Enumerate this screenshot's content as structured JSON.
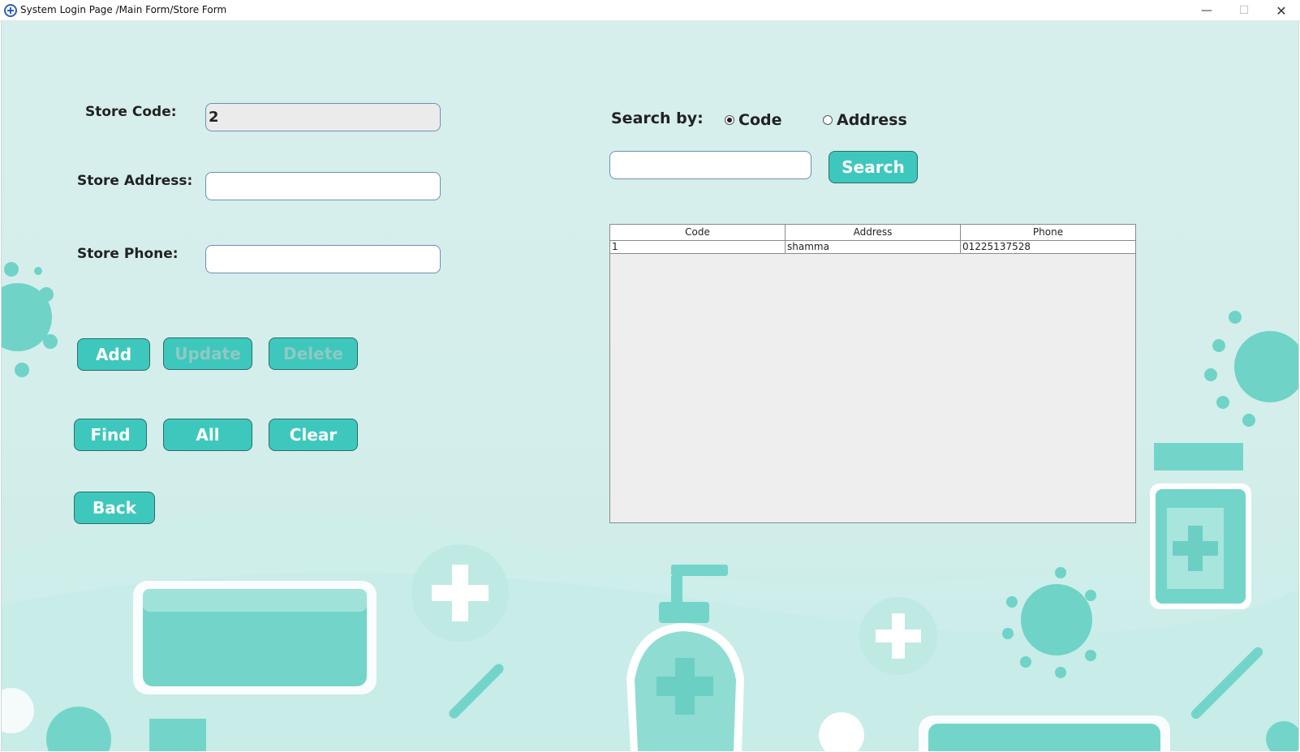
{
  "window": {
    "title": "System Login Page /Main Form/Store Form",
    "minimize_glyph": "—",
    "maximize_glyph": "☐",
    "close_glyph": "✕"
  },
  "form": {
    "store_code_label": "Store Code:",
    "store_code_value": "2",
    "store_address_label": "Store Address:",
    "store_address_value": "",
    "store_phone_label": "Store Phone:",
    "store_phone_value": ""
  },
  "buttons": {
    "add": "Add",
    "update": "Update",
    "delete": "Delete",
    "find": "Find",
    "all": "All",
    "clear": "Clear",
    "back": "Back",
    "search": "Search"
  },
  "search": {
    "label": "Search by:",
    "option_code": "Code",
    "option_address": "Address",
    "selected": "Code",
    "value": ""
  },
  "table": {
    "columns": [
      "Code",
      "Address",
      "Phone"
    ],
    "rows": [
      {
        "code": "1",
        "address": "shamma",
        "phone": "01225137528"
      }
    ]
  },
  "theme": {
    "accent": "#3ec8bd",
    "background": "#d7efec",
    "decor": "#74d3c8"
  }
}
